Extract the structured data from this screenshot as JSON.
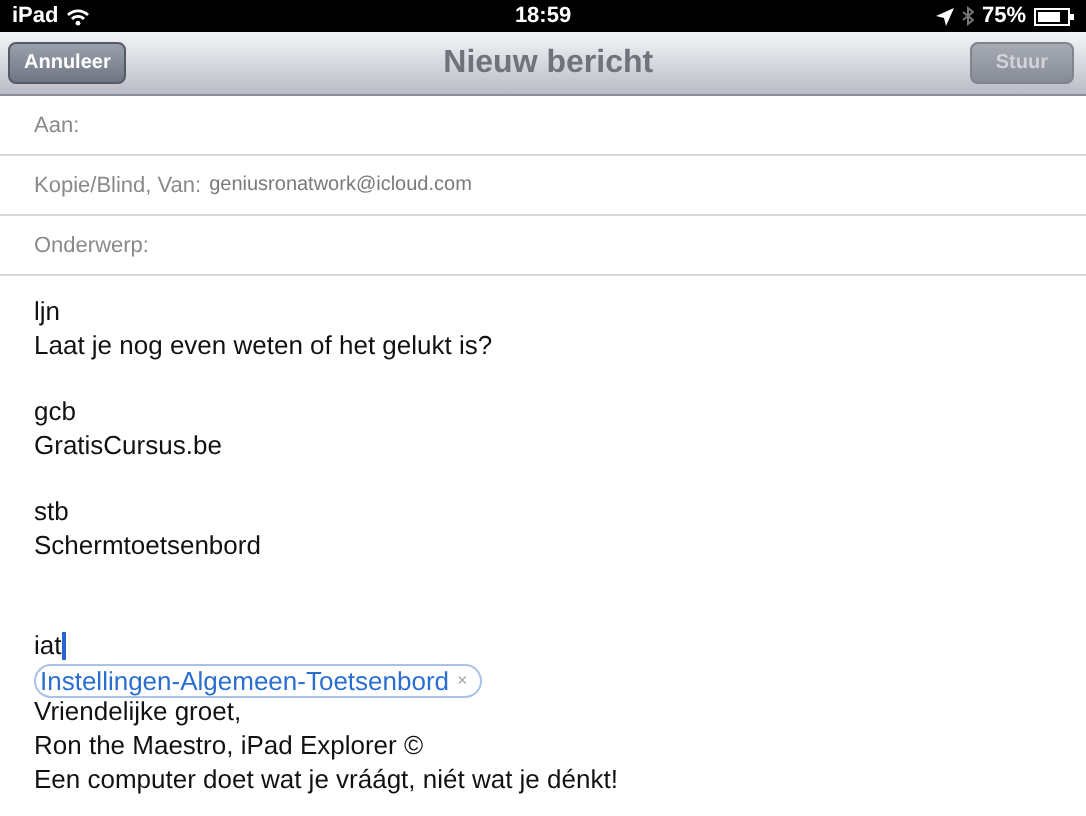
{
  "status_bar": {
    "device": "iPad",
    "time": "18:59",
    "battery": "75%"
  },
  "nav_bar": {
    "title": "Nieuw bericht",
    "cancel_button": {
      "label": "Annuleer",
      "disabled": false
    },
    "send_button": {
      "label": "Stuur",
      "disabled": true
    }
  },
  "fields": [
    {
      "label": "Aan:"
    },
    {
      "label": "Kopie/Blind, Van:",
      "value": "geniusronatwork@icloud.com"
    },
    {
      "label": "Onderwerp:"
    }
  ],
  "body": [
    {
      "kind": "text",
      "text": "ljn"
    },
    {
      "kind": "text",
      "text": "Laat je nog even weten of het gelukt is?"
    },
    {
      "kind": "gap"
    },
    {
      "kind": "text",
      "text": "gcb"
    },
    {
      "kind": "text",
      "text": "GratisCursus.be"
    },
    {
      "kind": "gap"
    },
    {
      "kind": "text",
      "text": "stb"
    },
    {
      "kind": "text",
      "text": "Schermtoetsenbord"
    },
    {
      "kind": "gap"
    },
    {
      "kind": "gap"
    },
    {
      "kind": "typing",
      "text": "iat"
    },
    {
      "kind": "suggestion",
      "text": "Instellingen-Algemeen-Toetsenbord",
      "close": "×"
    },
    {
      "kind": "text",
      "text": "Vriendelijke groet,"
    },
    {
      "kind": "text",
      "text": "Ron the Maestro, iPad Explorer ©"
    },
    {
      "kind": "text",
      "text": "Een computer doet wat je vráágt, niét wat je dénkt!"
    }
  ]
}
